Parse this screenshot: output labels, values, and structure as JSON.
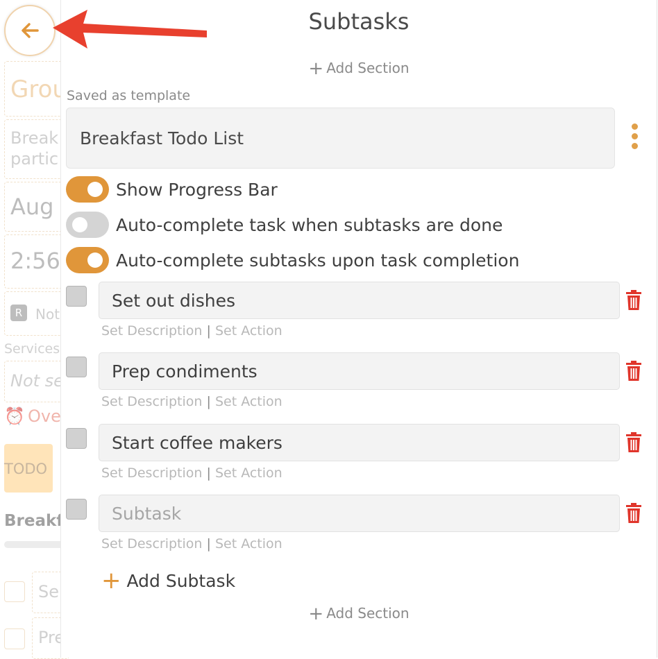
{
  "background": {
    "group_text": "Grou",
    "desc_line1": "Break",
    "desc_line2": "partic",
    "date_text": "Aug",
    "time_text": "2:56",
    "badge_letter": "R",
    "badge_text": "Not",
    "services_label": "Services",
    "services_value": "Not se",
    "overdue_text": "Ove",
    "status_button": "TODO",
    "list_title": "Breakf",
    "item1": "Se",
    "item2": "Pre"
  },
  "panel": {
    "title": "Subtasks",
    "add_section_label": "Add Section",
    "saved_as_template_label": "Saved as template",
    "template_name": "Breakfast Todo List"
  },
  "toggles": [
    {
      "label": "Show Progress Bar",
      "on": true
    },
    {
      "label": "Auto-complete task when subtasks are done",
      "on": false
    },
    {
      "label": "Auto-complete subtasks upon task completion",
      "on": true
    }
  ],
  "subtasks": [
    {
      "value": "Set out dishes",
      "placeholder": "Subtask",
      "checked": false
    },
    {
      "value": "Prep condiments",
      "placeholder": "Subtask",
      "checked": false
    },
    {
      "value": "Start coffee makers",
      "placeholder": "Subtask",
      "checked": false
    },
    {
      "value": "",
      "placeholder": "Subtask",
      "checked": false
    }
  ],
  "subtask_links": {
    "set_description": "Set Description",
    "separator": "|",
    "set_action": "Set Action"
  },
  "add_subtask_label": "Add Subtask",
  "icons": {
    "back": "arrow-left-icon",
    "kebab": "vertical-ellipsis-icon",
    "delete": "trash-icon",
    "add": "plus-icon",
    "alarm": "alarm-clock-icon"
  },
  "colors": {
    "accent": "#e0963a",
    "toggle_off": "#d4d4d4",
    "delete_red": "#e0352b",
    "annotation_arrow": "#e8402e"
  }
}
